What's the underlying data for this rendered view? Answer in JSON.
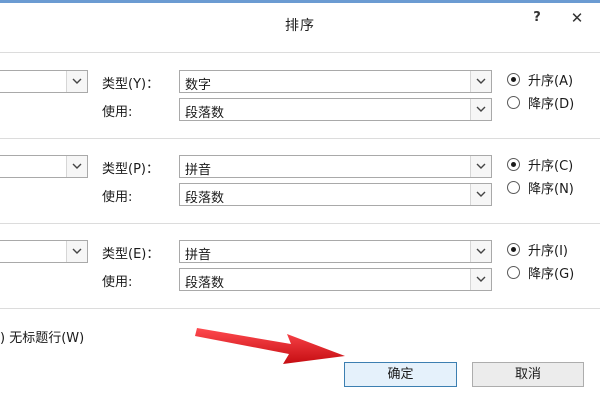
{
  "window": {
    "title": "排序",
    "help": "?",
    "close": "✕"
  },
  "sort_rows": [
    {
      "type_label": "类型(Y)：",
      "type_value": "数字",
      "use_label": "使用:",
      "use_value": "段落数",
      "asc_label": "升序(A)",
      "desc_label": "降序(D)",
      "selected": "asc"
    },
    {
      "type_label": "类型(P)：",
      "type_value": "拼音",
      "use_label": "使用:",
      "use_value": "段落数",
      "asc_label": "升序(C)",
      "desc_label": "降序(N)",
      "selected": "asc"
    },
    {
      "type_label": "类型(E)：",
      "type_value": "拼音",
      "use_label": "使用:",
      "use_value": "段落数",
      "asc_label": "升序(I)",
      "desc_label": "降序(G)",
      "selected": "asc"
    }
  ],
  "header_option": {
    "label": ") 无标题行(W)"
  },
  "buttons": {
    "ok": "确定",
    "cancel": "取消"
  },
  "colors": {
    "arrow": "#e8141b",
    "accent_border": "#3c7fb1"
  }
}
